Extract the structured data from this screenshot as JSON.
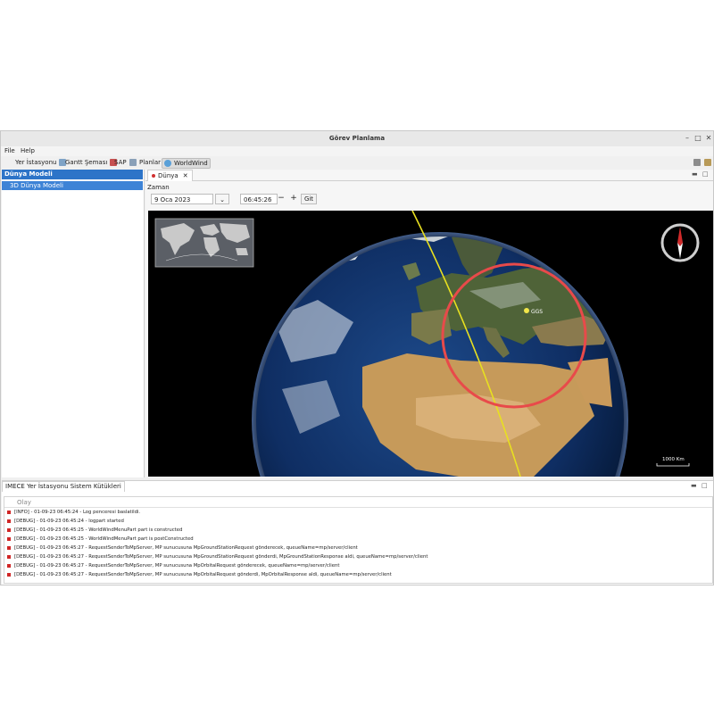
{
  "window": {
    "title": "Görev Planlama",
    "controls": [
      "–",
      "□",
      "✕"
    ]
  },
  "menubar": {
    "items": [
      "File",
      "Help"
    ]
  },
  "toolbar": {
    "items": [
      {
        "label": "Yer İstasyonu",
        "icon": "ground-station-icon"
      },
      {
        "label": "Gantt Şeması",
        "icon": "gantt-icon"
      },
      {
        "label": "SAP",
        "icon": "sap-icon"
      },
      {
        "label": "Planlar",
        "icon": "plans-icon"
      },
      {
        "label": "WorldWind",
        "icon": "worldwind-icon",
        "active": true
      }
    ]
  },
  "left_panel": {
    "header": "Dünya Modeli",
    "items": [
      "3D Dünya Modeli"
    ]
  },
  "editor": {
    "tab_label": "Dünya",
    "zaman_label": "Zaman",
    "date_value": "9 Oca 2023",
    "time_value": "06:45:26",
    "minus_label": "−",
    "plus_label": "+",
    "go_label": "Git",
    "dropdown_label": "⌄"
  },
  "worldview": {
    "ground_station_label": "GGS",
    "scale_label": "1000 Km",
    "footprint_color": "#e84a4a",
    "track_color": "#e8e020"
  },
  "log_panel": {
    "tab_label": "IMECE Yer İstasyonu Sistem Kütükleri",
    "column_header": "Olay",
    "rows": [
      "[INFO] - 01-09-23 06:45:24 - Log penceresi baslatildi.",
      "[DEBUG] - 01-09-23 06:45:24 - logpart started",
      "[DEBUG] - 01-09-23 06:45:25 - WorldWindMenuPart part is constructed",
      "[DEBUG] - 01-09-23 06:45:25 - WorldWindMenuPart part is postConstructed",
      "[DEBUG] - 01-09-23 06:45:27 - RequestSenderToMpServer, MP sunucusuna MpGroundStationRequest gönderecek, queueName=mp/server/client",
      "[DEBUG] - 01-09-23 06:45:27 - RequestSenderToMpServer, MP sunucusuna MpGroundStationRequest gönderdi, MpGroundStationResponse aldi, queueName=mp/server/client",
      "[DEBUG] - 01-09-23 06:45:27 - RequestSenderToMpServer, MP sunucusuna MpOrbitalRequest gönderecek, queueName=mp/server/client",
      "[DEBUG] - 01-09-23 06:45:27 - RequestSenderToMpServer, MP sunucusuna MpOrbitalRequest gönderdi, MpOrbitalResponse aldi, queueName=mp/server/client"
    ]
  }
}
